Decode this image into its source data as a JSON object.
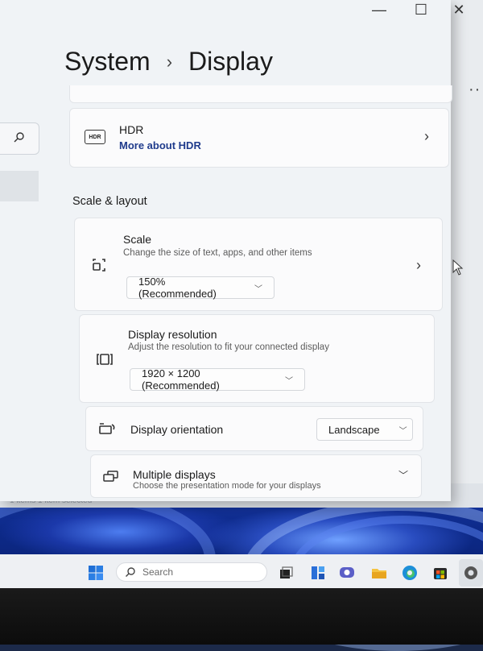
{
  "window": {
    "breadcrumb_parent": "System",
    "breadcrumb_separator": "›",
    "breadcrumb_current": "Display",
    "minimize": "—",
    "maximize": "☐",
    "close": "✕"
  },
  "hdr": {
    "badge": "HDR",
    "title": "HDR",
    "link": "More about HDR"
  },
  "scale_layout": {
    "section_title": "Scale & layout",
    "scale": {
      "title": "Scale",
      "subtitle": "Change the size of text, apps, and other items",
      "value": "150% (Recommended)"
    },
    "resolution": {
      "title": "Display resolution",
      "subtitle": "Adjust the resolution to fit your connected display",
      "value": "1920 × 1200 (Recommended)"
    },
    "orientation": {
      "title": "Display orientation",
      "value": "Landscape"
    },
    "multiple": {
      "title": "Multiple displays",
      "subtitle": "Choose the presentation mode for your displays"
    }
  },
  "background_window": {
    "status": "1 items     1 item selected"
  },
  "taskbar": {
    "search_placeholder": "Search",
    "icons": [
      "start-icon",
      "search-icon",
      "task-view-icon",
      "widgets-icon",
      "teams-chat-icon",
      "file-explorer-icon",
      "edge-icon",
      "store-icon",
      "settings-icon"
    ]
  },
  "colors": {
    "accent_link": "#1f3b8c",
    "window_bg": "#f0f3f6",
    "card_bg": "#fbfbfc",
    "wallpaper_blue": "#1a3aa8"
  }
}
